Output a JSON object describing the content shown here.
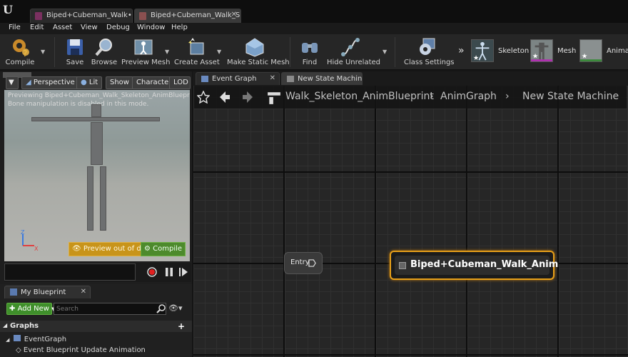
{
  "doc_tabs": [
    {
      "label": "Biped+Cubeman_Walk•"
    },
    {
      "label": "Biped+Cubeman_Walk_Sk"
    }
  ],
  "menu": [
    "File",
    "Edit",
    "Asset",
    "View",
    "Debug",
    "Window",
    "Help"
  ],
  "toolbar": {
    "compile": "Compile",
    "save": "Save",
    "browse": "Browse",
    "preview_mesh": "Preview Mesh",
    "create_asset": "Create Asset",
    "make_static_mesh": "Make Static Mesh",
    "find": "Find",
    "hide_unrelated": "Hide Unrelated",
    "class_settings": "Class Settings",
    "skeleton": "Skeleton",
    "mesh": "Mesh",
    "animation": "Animat"
  },
  "viewport": {
    "perspective": "Perspective",
    "lit": "Lit",
    "show": "Show",
    "character": "Character",
    "lod": "LOD A",
    "info_line1": "Previewing Biped+Cubeman_Walk_Skeleton_AnimBlueprint_C",
    "info_line2": "Bone manipulation is disabled in this mode.",
    "preview_warning": "Preview out of date",
    "compile_label": "Compile",
    "axis_z": "Z",
    "axis_x": "X"
  },
  "my_blueprint": {
    "tab_label": "My Blueprint",
    "add_new": "Add New",
    "search_placeholder": "Search",
    "graphs_header": "Graphs",
    "tree": [
      "EventGraph",
      "Event Blueprint Update Animation"
    ]
  },
  "graph_tabs": [
    {
      "label": "Event Graph"
    },
    {
      "label": "New State Machine"
    }
  ],
  "breadcrumb": {
    "blueprint": "Walk_Skeleton_AnimBlueprint",
    "graph": "AnimGraph",
    "state_machine": "New State Machine"
  },
  "nodes": {
    "entry": "Entry",
    "state": "Biped+Cubeman_Walk_Anim"
  },
  "colors": {
    "accent_orange": "#e8a019",
    "compile_green": "#4d8a2c",
    "warning_yellow": "#c8941a"
  }
}
